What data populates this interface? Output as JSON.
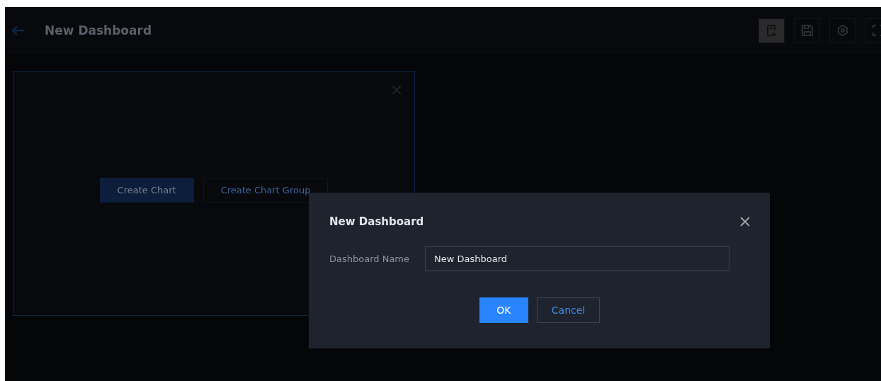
{
  "header": {
    "title": "New Dashboard",
    "toolbar": [
      {
        "kind": "add-chart",
        "selected": true
      },
      {
        "kind": "save",
        "selected": false
      },
      {
        "kind": "settings",
        "selected": false
      },
      {
        "kind": "fullscreen",
        "selected": false
      }
    ]
  },
  "panel": {
    "buttons": [
      {
        "label": "Create Chart",
        "kind": "primary"
      },
      {
        "label": "Create Chart Group",
        "kind": "secondary"
      }
    ]
  },
  "dialog": {
    "title": "New Dashboard",
    "field_label": "Dashboard Name",
    "field_value": "New Dashboard",
    "buttons": [
      {
        "label": "OK",
        "kind": "primary"
      },
      {
        "label": "Cancel",
        "kind": "secondary"
      }
    ]
  }
}
